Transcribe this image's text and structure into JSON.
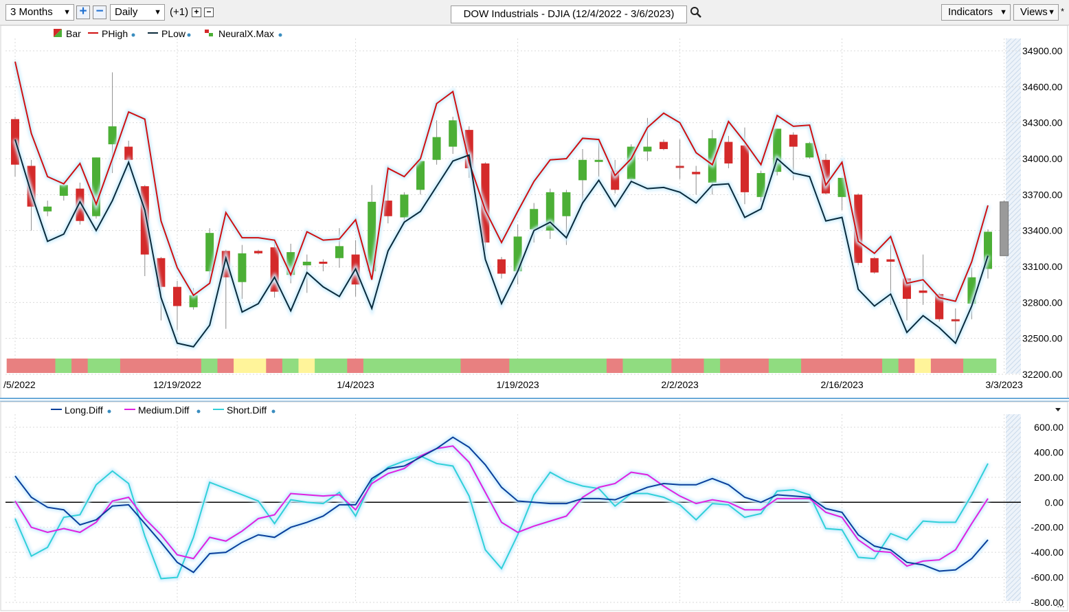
{
  "toolbar": {
    "range_select": "3 Months",
    "zoom_in_icon": "plus-icon",
    "zoom_out_icon": "minus-icon",
    "interval_select": "Daily",
    "offset_label": "(+1)",
    "symbol_title": "DOW Industrials - DJIA (12/4/2022 - 3/6/2023)",
    "search_icon": "magnifier-icon",
    "indicators_label": "Indicators",
    "views_label": "Views",
    "star_label": "*"
  },
  "colors": {
    "up": "#4caf36",
    "down": "#d42a2a",
    "flat": "#cc3333",
    "phigh": "#d01010",
    "plow": "#0a2a3a",
    "long": "#0a3f9a",
    "medium": "#e020e0",
    "short": "#30d0d8",
    "band_red": "#e88080",
    "band_green": "#90dc80",
    "band_yellow": "#fff49a",
    "grid": "#d9d9d9"
  },
  "chart_data": [
    {
      "type": "candlestick",
      "x_tick_labels": [
        "/5/2022",
        "12/19/2022",
        "1/4/2023",
        "1/19/2023",
        "2/2/2023",
        "2/16/2023",
        "3/3/2023"
      ],
      "x_tick_index": [
        0,
        10,
        21,
        31,
        41,
        51,
        61
      ],
      "y_ticks": [
        32200,
        32500,
        32800,
        33100,
        33400,
        33700,
        34000,
        34300,
        34600,
        34900
      ],
      "y_tick_labels": [
        "32200.00",
        "32500.00",
        "32800.00",
        "33100.00",
        "33400.00",
        "33700.00",
        "34000.00",
        "34300.00",
        "34600.00",
        "34900.00"
      ],
      "ylim": [
        32200,
        34990
      ],
      "legend": [
        "Bar",
        "PHigh",
        "PLow",
        "NeuralX.Max"
      ],
      "candles": [
        {
          "o": 34330,
          "h": 34350,
          "l": 33850,
          "c": 33950
        },
        {
          "o": 33940,
          "h": 33990,
          "l": 33400,
          "c": 33600
        },
        {
          "o": 33560,
          "h": 33650,
          "l": 33520,
          "c": 33600
        },
        {
          "o": 33690,
          "h": 33820,
          "l": 33650,
          "c": 33780
        },
        {
          "o": 33750,
          "h": 33800,
          "l": 33450,
          "c": 33480
        },
        {
          "o": 33520,
          "h": 34010,
          "l": 33500,
          "c": 34010
        },
        {
          "o": 34120,
          "h": 34720,
          "l": 33880,
          "c": 34270
        },
        {
          "o": 34100,
          "h": 34150,
          "l": 33900,
          "c": 33990
        },
        {
          "o": 33770,
          "h": 33780,
          "l": 33020,
          "c": 33200
        },
        {
          "o": 33170,
          "h": 33180,
          "l": 32650,
          "c": 32930
        },
        {
          "o": 32930,
          "h": 32980,
          "l": 32570,
          "c": 32770
        },
        {
          "o": 32760,
          "h": 32920,
          "l": 32740,
          "c": 32860
        },
        {
          "o": 33060,
          "h": 33420,
          "l": 33000,
          "c": 33380
        },
        {
          "o": 33230,
          "h": 33240,
          "l": 32580,
          "c": 33010
        },
        {
          "o": 32970,
          "h": 33280,
          "l": 32830,
          "c": 33210
        },
        {
          "o": 33230,
          "h": 33240,
          "l": 33200,
          "c": 33210
        },
        {
          "o": 33260,
          "h": 33330,
          "l": 32840,
          "c": 32890
        },
        {
          "o": 33030,
          "h": 33290,
          "l": 32960,
          "c": 33220
        },
        {
          "o": 33110,
          "h": 33200,
          "l": 32880,
          "c": 33140
        },
        {
          "o": 33140,
          "h": 33160,
          "l": 33060,
          "c": 33130
        },
        {
          "o": 33170,
          "h": 33420,
          "l": 33090,
          "c": 33270
        },
        {
          "o": 33200,
          "h": 33320,
          "l": 32850,
          "c": 32950
        },
        {
          "o": 33060,
          "h": 33780,
          "l": 33020,
          "c": 33640
        },
        {
          "o": 33650,
          "h": 33940,
          "l": 33460,
          "c": 33520
        },
        {
          "o": 33510,
          "h": 33720,
          "l": 33450,
          "c": 33700
        },
        {
          "o": 33740,
          "h": 34000,
          "l": 33700,
          "c": 33980
        },
        {
          "o": 33990,
          "h": 34320,
          "l": 33950,
          "c": 34180
        },
        {
          "o": 34100,
          "h": 34350,
          "l": 34040,
          "c": 34320
        },
        {
          "o": 34240,
          "h": 34270,
          "l": 33840,
          "c": 33920
        },
        {
          "o": 33960,
          "h": 33970,
          "l": 33230,
          "c": 33300
        },
        {
          "o": 33160,
          "h": 33180,
          "l": 33000,
          "c": 33040
        },
        {
          "o": 33060,
          "h": 33450,
          "l": 32950,
          "c": 33350
        },
        {
          "o": 33410,
          "h": 33630,
          "l": 33300,
          "c": 33580
        },
        {
          "o": 33400,
          "h": 33750,
          "l": 33330,
          "c": 33720
        },
        {
          "o": 33520,
          "h": 33740,
          "l": 33280,
          "c": 33720
        },
        {
          "o": 33820,
          "h": 34080,
          "l": 33640,
          "c": 33990
        },
        {
          "o": 33980,
          "h": 34170,
          "l": 33850,
          "c": 33990
        },
        {
          "o": 33900,
          "h": 33990,
          "l": 33710,
          "c": 33740
        },
        {
          "o": 33830,
          "h": 34120,
          "l": 33780,
          "c": 34100
        },
        {
          "o": 34060,
          "h": 34340,
          "l": 33980,
          "c": 34100
        },
        {
          "o": 34140,
          "h": 34160,
          "l": 34070,
          "c": 34080
        },
        {
          "o": 33940,
          "h": 34160,
          "l": 33830,
          "c": 33940
        },
        {
          "o": 33890,
          "h": 33940,
          "l": 33700,
          "c": 33870
        },
        {
          "o": 33800,
          "h": 34240,
          "l": 33700,
          "c": 34170
        },
        {
          "o": 34140,
          "h": 34190,
          "l": 33920,
          "c": 33960
        },
        {
          "o": 34110,
          "h": 34260,
          "l": 33620,
          "c": 33720
        },
        {
          "o": 33680,
          "h": 33900,
          "l": 33640,
          "c": 33880
        },
        {
          "o": 33890,
          "h": 34250,
          "l": 33860,
          "c": 34250
        },
        {
          "o": 34200,
          "h": 34220,
          "l": 33820,
          "c": 34100
        },
        {
          "o": 34010,
          "h": 34140,
          "l": 34000,
          "c": 34130
        },
        {
          "o": 33990,
          "h": 34040,
          "l": 33700,
          "c": 33710
        },
        {
          "o": 33680,
          "h": 33840,
          "l": 33570,
          "c": 33840
        },
        {
          "o": 33700,
          "h": 33710,
          "l": 33110,
          "c": 33130
        },
        {
          "o": 33170,
          "h": 33180,
          "l": 33040,
          "c": 33050
        },
        {
          "o": 33160,
          "h": 33280,
          "l": 32780,
          "c": 33140
        },
        {
          "o": 33000,
          "h": 33010,
          "l": 32650,
          "c": 32830
        },
        {
          "o": 32900,
          "h": 33200,
          "l": 32780,
          "c": 32880
        },
        {
          "o": 32870,
          "h": 32880,
          "l": 32640,
          "c": 32660
        },
        {
          "o": 32660,
          "h": 32750,
          "l": 32500,
          "c": 32660
        },
        {
          "o": 32790,
          "h": 33090,
          "l": 32660,
          "c": 33010
        },
        {
          "o": 33080,
          "h": 33410,
          "l": 33000,
          "c": 33390
        },
        {
          "o": 33640,
          "h": 33650,
          "l": 33190,
          "c": 33190
        }
      ],
      "phigh": [
        34810,
        34210,
        33850,
        33790,
        33960,
        33620,
        34000,
        34390,
        34330,
        33480,
        33090,
        32860,
        32960,
        33550,
        33340,
        33340,
        33320,
        33030,
        33390,
        33320,
        33330,
        33490,
        32990,
        33920,
        33850,
        34000,
        34460,
        34560,
        33970,
        33570,
        33300,
        33560,
        33810,
        33990,
        34000,
        34170,
        34160,
        33860,
        34000,
        34260,
        34380,
        34300,
        34050,
        33950,
        34310,
        34140,
        33950,
        34360,
        34270,
        34280,
        33780,
        33970,
        33310,
        33210,
        33350,
        32960,
        32990,
        32840,
        32810,
        33140,
        33610
      ],
      "plow": [
        34160,
        33710,
        33310,
        33370,
        33640,
        33400,
        33650,
        33970,
        33570,
        32840,
        32460,
        32430,
        32610,
        33170,
        32720,
        32790,
        33010,
        32730,
        33050,
        32930,
        32850,
        33080,
        32750,
        33230,
        33470,
        33560,
        33770,
        33980,
        34030,
        33160,
        32790,
        33060,
        33400,
        33470,
        33340,
        33630,
        33820,
        33600,
        33810,
        33750,
        33760,
        33720,
        33630,
        33780,
        33790,
        33510,
        33580,
        34000,
        33880,
        33850,
        33480,
        33510,
        32910,
        32770,
        32870,
        32550,
        32690,
        32590,
        32460,
        32770,
        33190
      ],
      "neuralx_band": [
        "red",
        "red",
        "red",
        "green",
        "red",
        "green",
        "green",
        "red",
        "red",
        "red",
        "red",
        "red",
        "green",
        "red",
        "yellow",
        "yellow",
        "red",
        "green",
        "yellow",
        "green",
        "green",
        "red",
        "green",
        "green",
        "green",
        "green",
        "green",
        "green",
        "red",
        "red",
        "red",
        "green",
        "green",
        "green",
        "green",
        "green",
        "green",
        "red",
        "green",
        "green",
        "green",
        "red",
        "red",
        "green",
        "red",
        "red",
        "red",
        "green",
        "green",
        "red",
        "red",
        "red",
        "red",
        "red",
        "green",
        "red",
        "yellow",
        "red",
        "red",
        "green",
        "green"
      ]
    },
    {
      "type": "line",
      "legend": [
        "Long.Diff",
        "Medium.Diff",
        "Short.Diff"
      ],
      "y_ticks": [
        -800,
        -600,
        -400,
        -200,
        0,
        200,
        400,
        600
      ],
      "y_tick_labels": [
        "-800.00",
        "-600.00",
        "-400.00",
        "-200.00",
        "0.00",
        "200.00",
        "400.00",
        "600.00"
      ],
      "ylim": [
        -800,
        640
      ],
      "series": [
        {
          "name": "Long.Diff",
          "values": [
            210,
            40,
            -40,
            -60,
            -180,
            -140,
            -30,
            -20,
            -170,
            -320,
            -480,
            -560,
            -410,
            -400,
            -320,
            -260,
            -280,
            -200,
            -160,
            -110,
            -20,
            -20,
            190,
            270,
            290,
            360,
            430,
            520,
            440,
            300,
            120,
            10,
            0,
            -10,
            -10,
            30,
            30,
            20,
            70,
            120,
            150,
            140,
            140,
            190,
            140,
            40,
            0,
            60,
            50,
            40,
            -50,
            -80,
            -260,
            -350,
            -380,
            -480,
            -500,
            -550,
            -540,
            -450,
            -300
          ],
          "color": "#0a3f9a"
        },
        {
          "name": "Medium.Diff",
          "values": [
            10,
            -200,
            -240,
            -210,
            -240,
            -160,
            10,
            40,
            -130,
            -260,
            -420,
            -450,
            -280,
            -310,
            -230,
            -130,
            -100,
            70,
            60,
            50,
            60,
            -60,
            150,
            230,
            270,
            370,
            430,
            450,
            320,
            80,
            -160,
            -240,
            -190,
            -150,
            -110,
            40,
            120,
            150,
            240,
            220,
            130,
            50,
            -10,
            20,
            0,
            -60,
            -60,
            30,
            30,
            30,
            -80,
            -120,
            -300,
            -390,
            -400,
            -510,
            -470,
            -460,
            -380,
            -170,
            30
          ],
          "color": "#e020e0"
        },
        {
          "name": "Short.Diff",
          "values": [
            -130,
            -430,
            -360,
            -120,
            -100,
            140,
            250,
            150,
            -270,
            -610,
            -600,
            -280,
            160,
            110,
            60,
            10,
            -170,
            20,
            0,
            -10,
            80,
            -110,
            170,
            280,
            330,
            370,
            310,
            290,
            50,
            -380,
            -530,
            -260,
            60,
            240,
            170,
            130,
            110,
            -30,
            70,
            70,
            40,
            -20,
            -140,
            -10,
            -20,
            -120,
            -90,
            90,
            100,
            60,
            -210,
            -220,
            -440,
            -450,
            -250,
            -300,
            -150,
            -160,
            -160,
            60,
            310
          ],
          "color": "#30d0d8"
        }
      ]
    }
  ]
}
